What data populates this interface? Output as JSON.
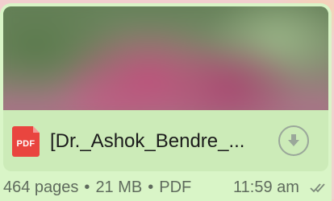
{
  "message": {
    "file": {
      "icon_label": "PDF",
      "name": "[Dr._Ashok_Bendre_...",
      "pages": "464 pages",
      "size": "21 MB",
      "type": "PDF"
    },
    "separator": "•",
    "time": "11:59 am",
    "status_icon": "double-check-icon",
    "download_icon": "download-arrow-icon"
  },
  "colors": {
    "bubble": "#d9f5c7",
    "file_row": "#ccebb8",
    "pdf_red": "#e9453f",
    "meta_text": "#5f6b5d"
  }
}
